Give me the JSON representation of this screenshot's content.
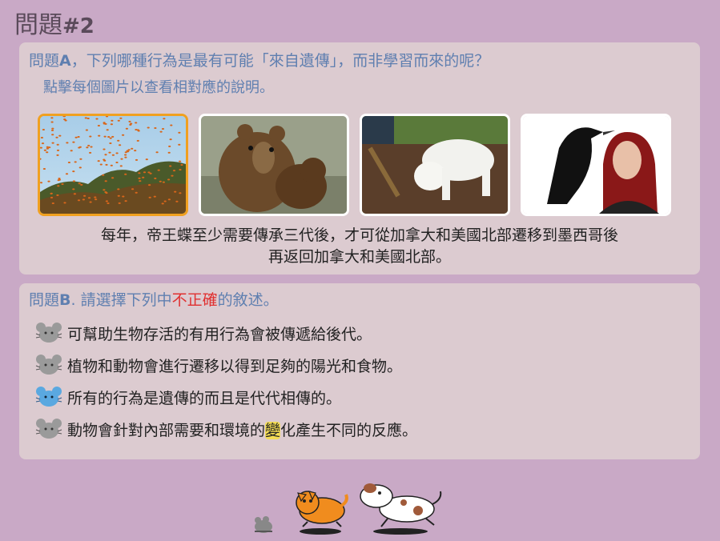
{
  "header": {
    "title_cjk": "問題",
    "title_num": "#2"
  },
  "questionA": {
    "label": "問題",
    "letter": "A",
    "text": "，下列哪種行為是最有可能「來自遺傳」，而非學習而來的呢？",
    "hint": "點擊每個圖片以查看相對應的說明。",
    "images": [
      {
        "name": "butterflies-image",
        "selected": true
      },
      {
        "name": "bears-image",
        "selected": false
      },
      {
        "name": "dog-digging-image",
        "selected": false
      },
      {
        "name": "crow-woman-image",
        "selected": false
      }
    ],
    "description_line1": "每年，帝王蝶至少需要傳承三代後，才可從加拿大和美國北部遷移到墨西哥後",
    "description_line2": "再返回加拿大和美國北部。"
  },
  "questionB": {
    "label": "問題",
    "letter": "B",
    "text_pre": ". 請選擇下列中",
    "text_red": "不正確",
    "text_post": "的敘述。",
    "options": [
      {
        "text": "可幫助生物存活的有用行為會被傳遞給後代。",
        "selected": false
      },
      {
        "text": "植物和動物會進行遷移以得到足夠的陽光和食物。",
        "selected": false
      },
      {
        "text": "所有的行為是遺傳的而且是代代相傳的。",
        "selected": true
      },
      {
        "text_pre": "動物會針對內部需要和環境的",
        "text_hl": "變",
        "text_post": "化產生不同的反應。",
        "selected": false
      }
    ]
  },
  "colors": {
    "accent": "#5f7fb0",
    "selected_border": "#f0a020",
    "incorrect_red": "#e03030",
    "mouse_selected": "#5aa8e0",
    "mouse_default": "#9a9a9a"
  }
}
